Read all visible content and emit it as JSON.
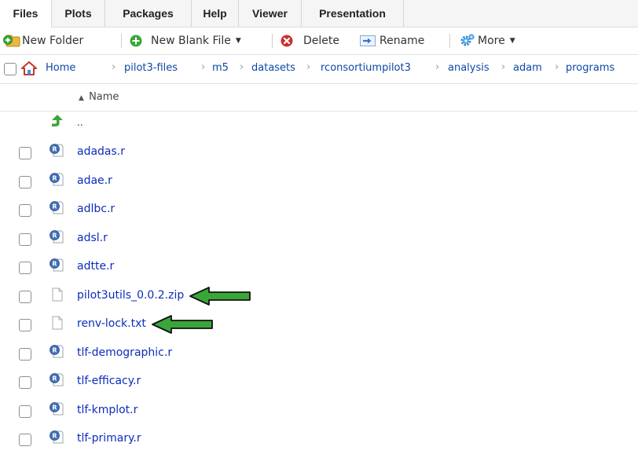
{
  "tabs": [
    "Files",
    "Plots",
    "Packages",
    "Help",
    "Viewer",
    "Presentation"
  ],
  "toolbar": {
    "new_folder": "New Folder",
    "new_blank_file": "New Blank File",
    "delete": "Delete",
    "rename": "Rename",
    "more": "More"
  },
  "breadcrumb": [
    "Home",
    "pilot3-files",
    "m5",
    "datasets",
    "rconsortiumpilot3",
    "analysis",
    "adam",
    "programs"
  ],
  "column_header": {
    "name": "Name",
    "sort_indicator": "▲"
  },
  "parent_dir": {
    "label": "..",
    "icon": "up-arrow-icon"
  },
  "files": [
    {
      "name": "adadas.r",
      "type": "r-script",
      "highlighted": false
    },
    {
      "name": "adae.r",
      "type": "r-script",
      "highlighted": false
    },
    {
      "name": "adlbc.r",
      "type": "r-script",
      "highlighted": false
    },
    {
      "name": "adsl.r",
      "type": "r-script",
      "highlighted": false
    },
    {
      "name": "adtte.r",
      "type": "r-script",
      "highlighted": false
    },
    {
      "name": "pilot3utils_0.0.2.zip",
      "type": "file",
      "highlighted": true
    },
    {
      "name": "renv-lock.txt",
      "type": "file",
      "highlighted": true
    },
    {
      "name": "tlf-demographic.r",
      "type": "r-script",
      "highlighted": false
    },
    {
      "name": "tlf-efficacy.r",
      "type": "r-script",
      "highlighted": false
    },
    {
      "name": "tlf-kmplot.r",
      "type": "r-script",
      "highlighted": false
    },
    {
      "name": "tlf-primary.r",
      "type": "r-script",
      "highlighted": false
    }
  ],
  "colors": {
    "link": "#0d2cbc",
    "annotation_arrow": "#3aa637",
    "home_icon": "#c0392b",
    "up_arrow": "#3aa637"
  }
}
